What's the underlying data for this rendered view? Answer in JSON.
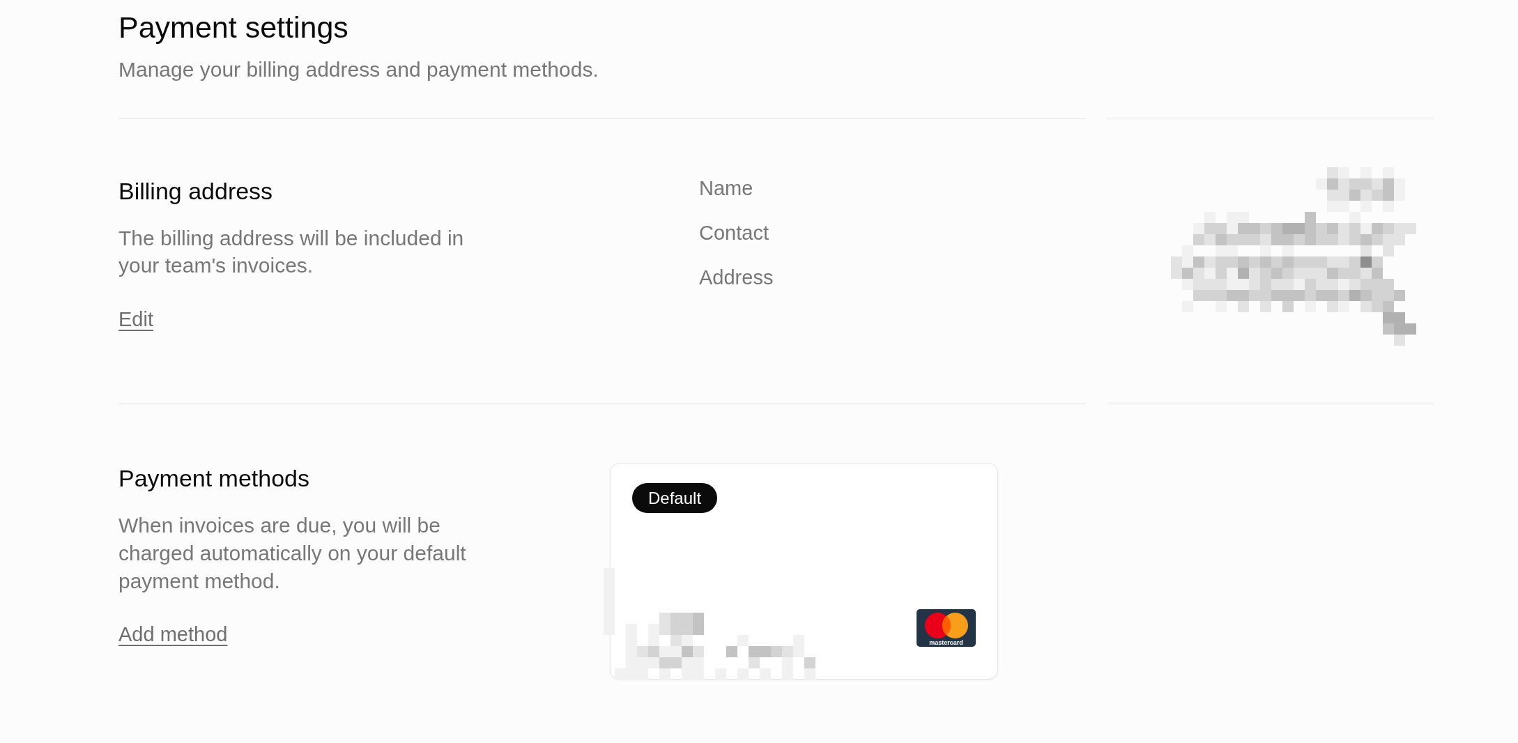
{
  "header": {
    "title": "Payment settings",
    "subtitle": "Manage your billing address and payment methods."
  },
  "billing_address": {
    "title": "Billing address",
    "description": "The billing address will be included in your team's invoices.",
    "action": "Edit",
    "fields": [
      {
        "label": "Name"
      },
      {
        "label": "Contact"
      },
      {
        "label": "Address"
      }
    ],
    "values_redacted": true
  },
  "payment_methods": {
    "title": "Payment methods",
    "description": "When invoices are due, you will be charged automatically on your default payment method.",
    "action": "Add method",
    "cards": [
      {
        "badge": "Default",
        "brand_logo_text": "mastercard",
        "details_redacted": true
      }
    ]
  }
}
